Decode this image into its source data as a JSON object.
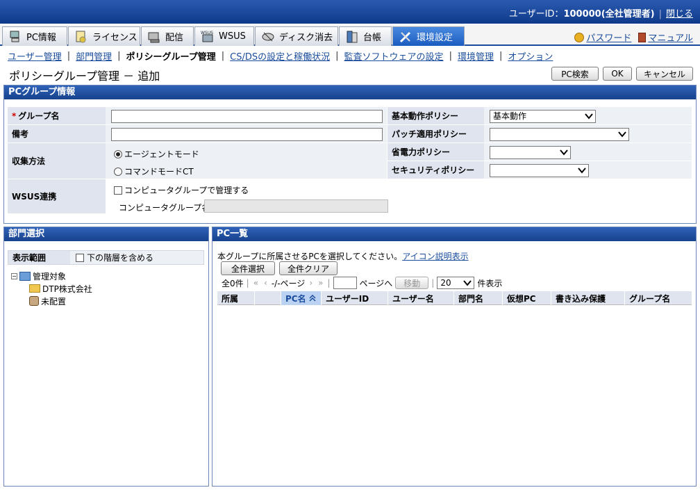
{
  "header": {
    "user_label": "ユーザーID：",
    "user_value": "100000(全社管理者)",
    "close_link": "閉じる"
  },
  "tabs": [
    {
      "label": "PC情報",
      "icon": "pc-icon"
    },
    {
      "label": "ライセンス",
      "icon": "license-icon"
    },
    {
      "label": "配信",
      "icon": "distribution-icon"
    },
    {
      "label": "WSUS",
      "icon": "wsus-icon",
      "icon_text": "WSUS"
    },
    {
      "label": "ディスク消去",
      "icon": "disk-erase-icon"
    },
    {
      "label": "台帳",
      "icon": "ledger-icon"
    },
    {
      "label": "環境設定",
      "icon": "tools-icon"
    }
  ],
  "header_links": {
    "password": "パスワード",
    "manual": "マニュアル"
  },
  "subnav": [
    {
      "label": "ユーザー管理",
      "current": false
    },
    {
      "label": "部門管理",
      "current": false
    },
    {
      "label": "ポリシーグループ管理",
      "current": true
    },
    {
      "label": "CS/DSの設定と稼働状況",
      "current": false
    },
    {
      "label": "監査ソフトウェアの設定",
      "current": false
    },
    {
      "label": "環境管理",
      "current": false
    },
    {
      "label": "オプション",
      "current": false
    }
  ],
  "page": {
    "title": "ポリシーグループ管理 － 追加",
    "buttons": {
      "search": "PC検索",
      "ok": "OK",
      "cancel": "キャンセル"
    }
  },
  "pc_group": {
    "section_title": "PCグループ情報",
    "required_mark": "*",
    "group_name_label": "グループ名",
    "group_name_value": "",
    "note_label": "備考",
    "note_value": "",
    "collect_label": "収集方法",
    "collect_options": [
      "エージェントモード",
      "コマンドモードCT"
    ],
    "collect_selected": 0,
    "wsus_label": "WSUS連携",
    "wsus_checkbox": "コンピュータグループで管理する",
    "wsus_group_label": "コンピュータグループ名",
    "wsus_group_value": "",
    "basic_policy_label": "基本動作ポリシー",
    "basic_policy_value": "基本動作",
    "patch_policy_label": "パッチ適用ポリシー",
    "patch_policy_value": "",
    "power_policy_label": "省電力ポリシー",
    "power_policy_value": "",
    "security_policy_label": "セキュリティポリシー",
    "security_policy_value": ""
  },
  "dept": {
    "section_title": "部門選択",
    "range_label": "表示範囲",
    "include_lower": "下の階層を含める",
    "tree": {
      "root": "管理対象",
      "children": [
        "DTP株式会社",
        "未配置"
      ]
    }
  },
  "pc_list": {
    "section_title": "PC一覧",
    "instruction": "本グループに所属させるPCを選択してください。",
    "icon_link": "アイコン説明表示",
    "select_all": "全件選択",
    "clear_all": "全件クリア",
    "total": "全0件",
    "pager": "-/-ページ",
    "page_to": "ページへ",
    "move": "移動",
    "per_page": "20",
    "per_page_suffix": "件表示",
    "columns": [
      "所属",
      "PC名",
      "ユーザーID",
      "ユーザー名",
      "部門名",
      "仮想PC",
      "書き込み保護",
      "グループ名"
    ],
    "sorted_column": 1
  }
}
